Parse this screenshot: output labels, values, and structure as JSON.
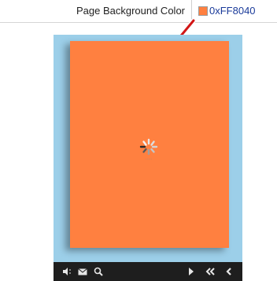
{
  "property": {
    "label": "Page Background Color",
    "value": "0xFF8040",
    "color": "#ff8040"
  },
  "preview": {
    "frame_color": "#9ccfe9",
    "page_color": "#ff8040"
  },
  "toolbar": {
    "buttons": [
      {
        "icon": "sound-icon"
      },
      {
        "icon": "email-icon"
      },
      {
        "icon": "zoom-icon"
      },
      {
        "icon": "next-page-icon"
      },
      {
        "icon": "first-page-icon"
      },
      {
        "icon": "previous-page-icon"
      }
    ]
  }
}
